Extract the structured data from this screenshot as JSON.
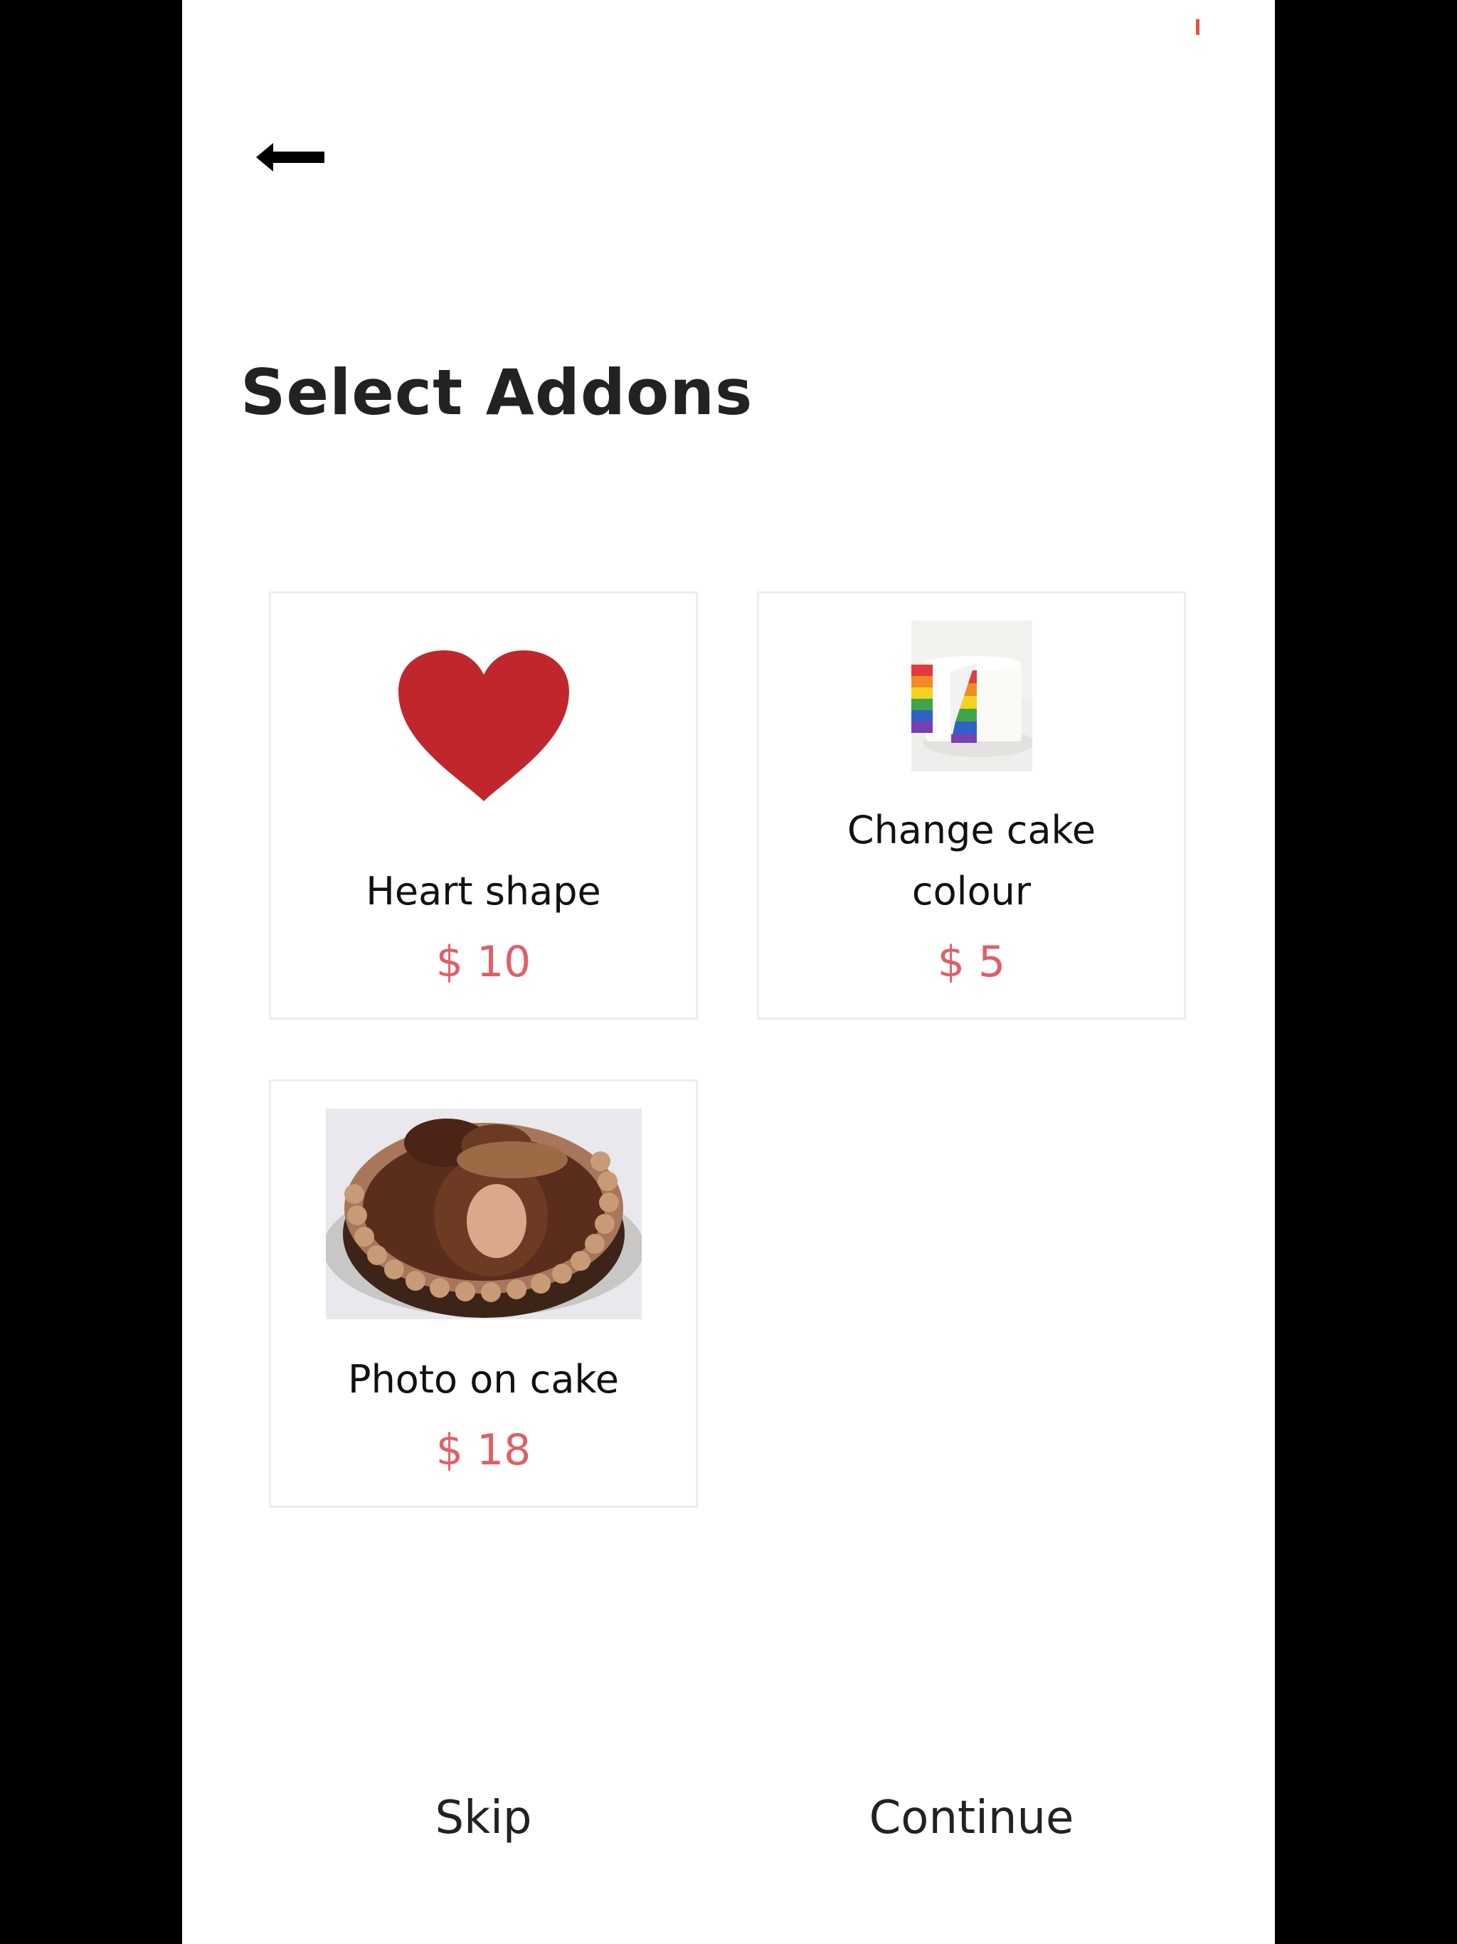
{
  "header": {
    "back_icon": "arrow-left-icon"
  },
  "page": {
    "title": "Select Addons"
  },
  "addons": [
    {
      "name": "Heart shape",
      "price": "$ 10",
      "image": "heart-icon"
    },
    {
      "name_line1": "Change cake",
      "name_line2": "colour",
      "price": "$ 5",
      "image": "rainbow-cake-slice-image"
    },
    {
      "name": "Photo on cake",
      "price": "$ 18",
      "image": "photo-cake-image"
    }
  ],
  "footer": {
    "skip_label": "Skip",
    "continue_label": "Continue"
  },
  "colors": {
    "price": "#df5f68",
    "heart": "#c0272d",
    "accent_status": "#e0533d"
  }
}
